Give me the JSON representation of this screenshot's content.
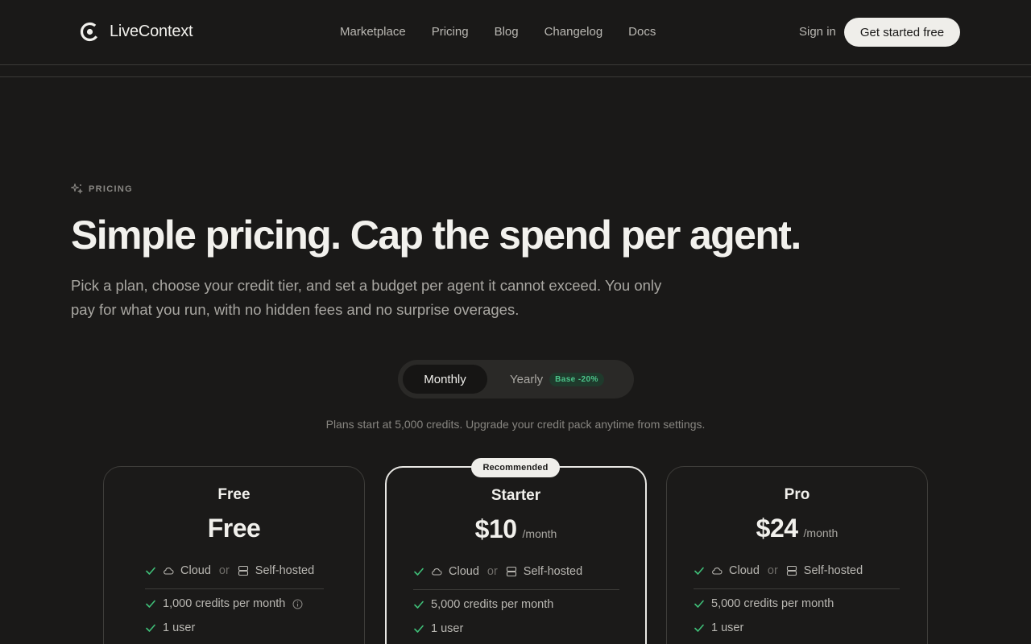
{
  "header": {
    "brand": "LiveContext",
    "nav": [
      "Marketplace",
      "Pricing",
      "Blog",
      "Changelog",
      "Docs"
    ],
    "sign_in": "Sign in",
    "cta": "Get started free"
  },
  "hero": {
    "eyebrow": "PRICING",
    "title": "Simple pricing. Cap the spend per agent.",
    "subtitle": "Pick a plan, choose your credit tier, and set a budget per agent it cannot exceed. You only pay for what you run, with no hidden fees and no surprise overages."
  },
  "billing_toggle": {
    "monthly": "Monthly",
    "yearly": "Yearly",
    "yearly_badge": "Base -20%",
    "selected": "Monthly"
  },
  "plans_note": "Plans start at 5,000 credits. Upgrade your credit pack anytime from settings.",
  "recommended_badge": "Recommended",
  "plans": [
    {
      "name": "Free",
      "price": "Free",
      "period": "",
      "hosting_cloud": "Cloud",
      "hosting_or": "or",
      "hosting_self": "Self-hosted",
      "credits": "1,000 credits per month",
      "users": "1 user"
    },
    {
      "name": "Starter",
      "price": "$10",
      "period": "/month",
      "hosting_cloud": "Cloud",
      "hosting_or": "or",
      "hosting_self": "Self-hosted",
      "credits": "5,000 credits per month",
      "users": "1 user"
    },
    {
      "name": "Pro",
      "price": "$24",
      "period": "/month",
      "hosting_cloud": "Cloud",
      "hosting_or": "or",
      "hosting_self": "Self-hosted",
      "credits": "5,000 credits per month",
      "users": "1 user"
    }
  ],
  "colors": {
    "background": "#1a1918",
    "accent_check": "#3fbf78",
    "cta_bg": "#efeeea"
  }
}
